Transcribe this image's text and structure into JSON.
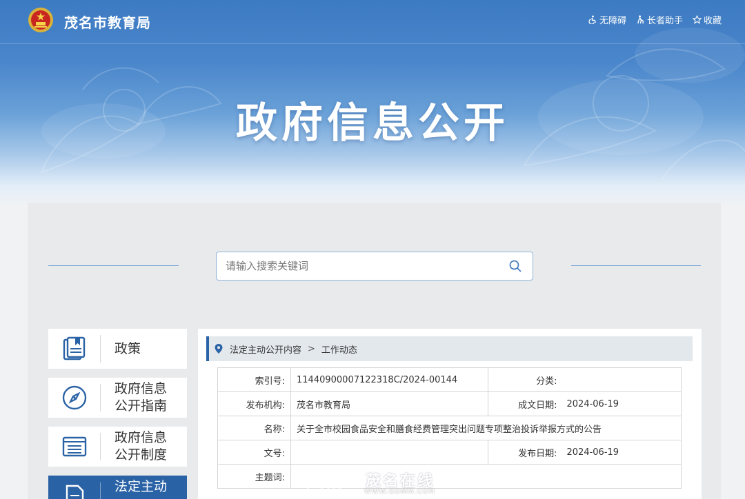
{
  "header": {
    "site_title": "茂名市教育局",
    "tools": [
      {
        "label": "无障碍",
        "icon": "accessibility-icon"
      },
      {
        "label": "长者助手",
        "icon": "elder-assist-icon"
      },
      {
        "label": "收藏",
        "icon": "star-icon"
      }
    ]
  },
  "hero": {
    "title": "政府信息公开"
  },
  "search": {
    "placeholder": "请输入搜索关键词"
  },
  "sidebar": {
    "items": [
      {
        "label_1": "政策",
        "label_2": "",
        "icon": "document-icon",
        "active": false
      },
      {
        "label_1": "政府信息",
        "label_2": "公开指南",
        "icon": "compass-icon",
        "active": false
      },
      {
        "label_1": "政府信息",
        "label_2": "公开制度",
        "icon": "list-icon",
        "active": false
      },
      {
        "label_1": "法定主动",
        "label_2": "",
        "icon": "file-icon",
        "active": true
      }
    ]
  },
  "breadcrumb": {
    "level_1": "法定主动公开内容",
    "separator": ">",
    "level_2": "工作动态"
  },
  "info": {
    "index_label": "索引号:",
    "index_value": "11440900007122318C/2024-00144",
    "category_label": "分类:",
    "category_value": "",
    "publisher_label": "发布机构:",
    "publisher_value": "茂名市教育局",
    "written_label": "成文日期:",
    "written_value": "2024-06-19",
    "name_label": "名称:",
    "name_value": "关于全市校园食品安全和膳食经费管理突出问题专项整治投诉举报方式的公告",
    "doc_no_label": "文号:",
    "doc_no_value": "",
    "published_label": "发布日期:",
    "published_value": "2024-06-19",
    "subject_label": "主题词:",
    "subject_value": ""
  },
  "watermark": {
    "text": "茂名在线",
    "url": "WWW.GDMM.COM"
  },
  "colors": {
    "accent": "#2a62a6",
    "banner_top": "#3c7ac2"
  }
}
